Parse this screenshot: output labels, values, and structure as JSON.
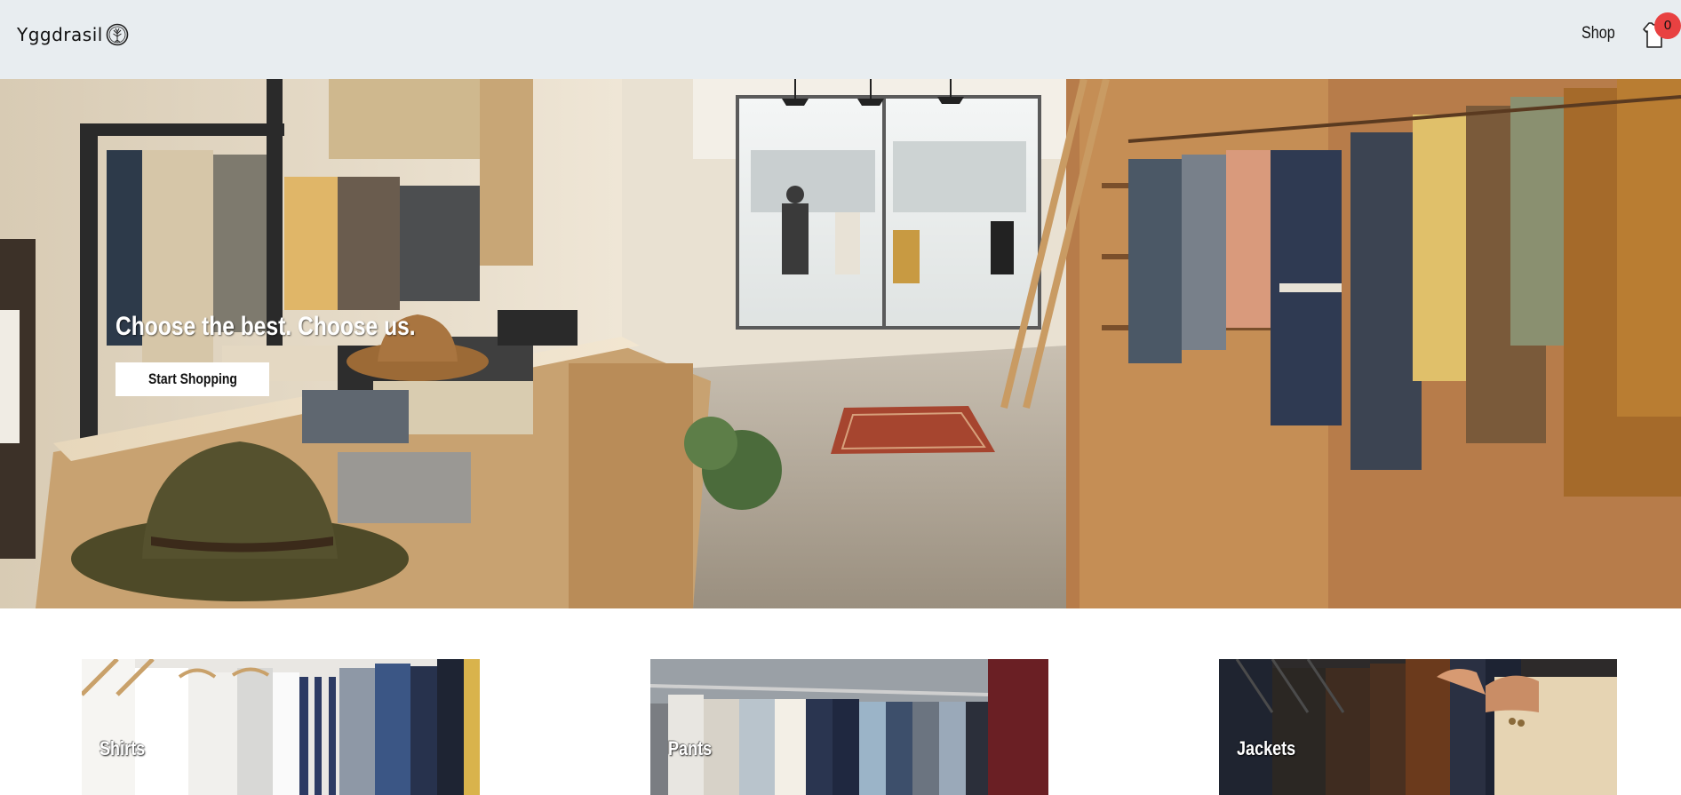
{
  "header": {
    "brand_name": "Yggdrasil",
    "brand_icon": "tree-of-life-icon",
    "nav_shop": "Shop",
    "cart_icon": "shopping-bag-icon",
    "cart_count": "0",
    "badge_color": "#e84141",
    "background": "#e8edf0"
  },
  "hero": {
    "headline": "Choose the best. Choose us.",
    "cta_label": "Start Shopping",
    "image": "clothing-store-interior-photo"
  },
  "categories": [
    {
      "label": "Shirts",
      "image": "shirts-on-hangers-photo"
    },
    {
      "label": "Pants",
      "image": "pants-on-rack-photo"
    },
    {
      "label": "Jackets",
      "image": "jackets-on-rack-photo"
    }
  ]
}
